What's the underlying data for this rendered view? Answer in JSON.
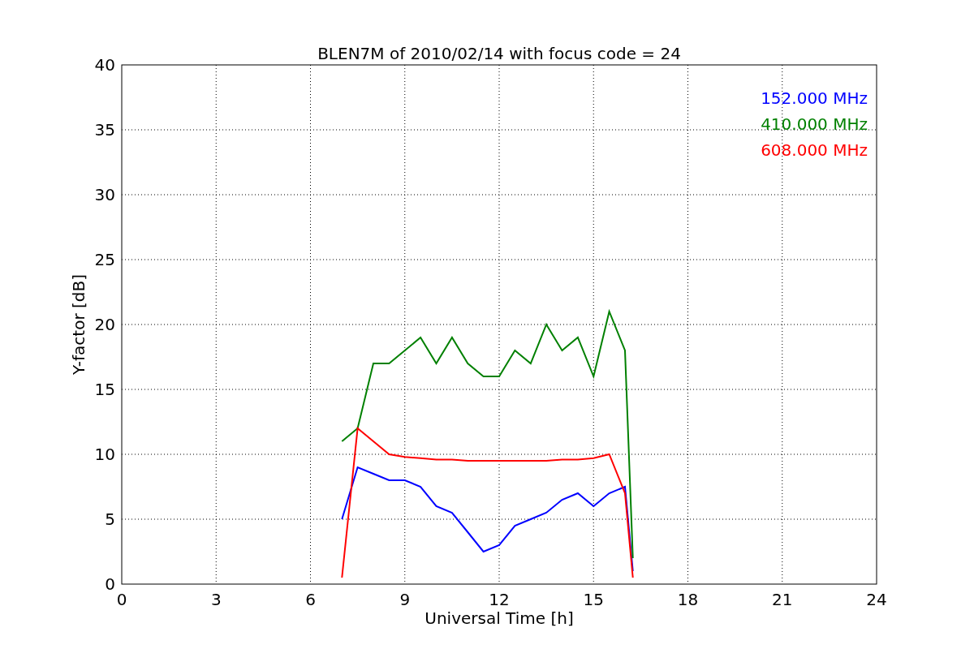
{
  "chart_data": {
    "type": "line",
    "title": "BLEN7M of 2010/02/14 with focus code = 24",
    "xlabel": "Universal Time [h]",
    "ylabel": "Y-factor [dB]",
    "x": [
      7,
      7.5,
      8,
      8.5,
      9,
      9.5,
      10,
      10.5,
      11,
      11.5,
      12,
      12.5,
      13,
      13.5,
      14,
      14.5,
      15,
      15.5,
      16,
      16.25
    ],
    "series": [
      {
        "name": "152.000 MHz",
        "color": "#0000ff",
        "values": [
          5,
          9,
          8.5,
          8,
          8,
          7.5,
          6,
          5.5,
          4,
          2.5,
          3,
          4.5,
          5,
          5.5,
          6.5,
          7,
          6,
          7,
          7.5,
          1
        ]
      },
      {
        "name": "410.000 MHz",
        "color": "#008000",
        "values": [
          11,
          12,
          17,
          17,
          18,
          19,
          17,
          19,
          17,
          16,
          16,
          18,
          17,
          20,
          18,
          19,
          16,
          21,
          18,
          2
        ]
      },
      {
        "name": "608.000 MHz",
        "color": "#ff0000",
        "values": [
          0.5,
          12,
          11,
          10,
          9.8,
          9.7,
          9.6,
          9.6,
          9.5,
          9.5,
          9.5,
          9.5,
          9.5,
          9.5,
          9.6,
          9.6,
          9.7,
          10,
          7,
          0.5
        ]
      }
    ],
    "xlim": [
      0,
      24
    ],
    "ylim": [
      0,
      40
    ],
    "xticks": [
      0,
      3,
      6,
      9,
      12,
      15,
      18,
      21,
      24
    ],
    "yticks": [
      0,
      5,
      10,
      15,
      20,
      25,
      30,
      35,
      40
    ],
    "grid": true
  }
}
